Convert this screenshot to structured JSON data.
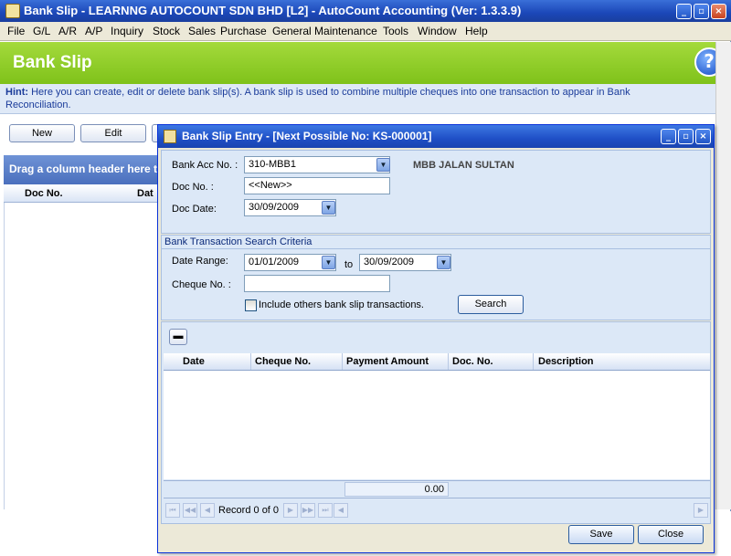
{
  "window": {
    "title": "Bank Slip - LEARNNG AUTOCOUNT SDN BHD [L2] - AutoCount Accounting (Ver: 1.3.3.9)",
    "minimize": "_",
    "restore": "▫",
    "close": "×"
  },
  "menu": [
    "File",
    "G/L",
    "A/R",
    "A/P",
    "Inquiry",
    "Stock",
    "Sales",
    "Purchase",
    "General Maintenance",
    "Tools",
    "Window",
    "Help"
  ],
  "header": {
    "title": "Bank Slip",
    "help": "?"
  },
  "hint": {
    "label": "Hint:",
    "text": "Here you can create, edit or delete bank slip(s). A bank slip is used to combine multiple cheques into one transaction to appear in Bank Reconciliation."
  },
  "toolbar": {
    "new_label": "New",
    "edit_label": "Edit"
  },
  "grid": {
    "group_hint": "Drag a column header here to",
    "columns": [
      "Doc No.",
      "Dat"
    ]
  },
  "dialog": {
    "title": "Bank Slip Entry - [Next Possible No: KS-000001]",
    "bank_acc_label": "Bank Acc No. :",
    "bank_acc_value": "310-MBB1",
    "bank_name": "MBB JALAN SULTAN",
    "doc_no_label": "Doc No. :",
    "doc_no_value": "<<New>>",
    "doc_date_label": "Doc Date:",
    "doc_date_value": "30/09/2009",
    "search_section_title": "Bank Transaction Search Criteria",
    "date_range_label": "Date Range:",
    "date_from": "01/01/2009",
    "date_to_label": "to",
    "date_to": "30/09/2009",
    "cheque_no_label": "Cheque No. :",
    "cheque_no_value": "",
    "include_label": "Include others bank slip transactions.",
    "include_checked": false,
    "search_label": "Search",
    "table_columns": [
      "Date",
      "Cheque No.",
      "Payment Amount",
      "Doc. No.",
      "Description"
    ],
    "total_amount": "0.00",
    "record_text": "Record 0 of 0",
    "save_label": "Save",
    "close_label": "Close"
  }
}
